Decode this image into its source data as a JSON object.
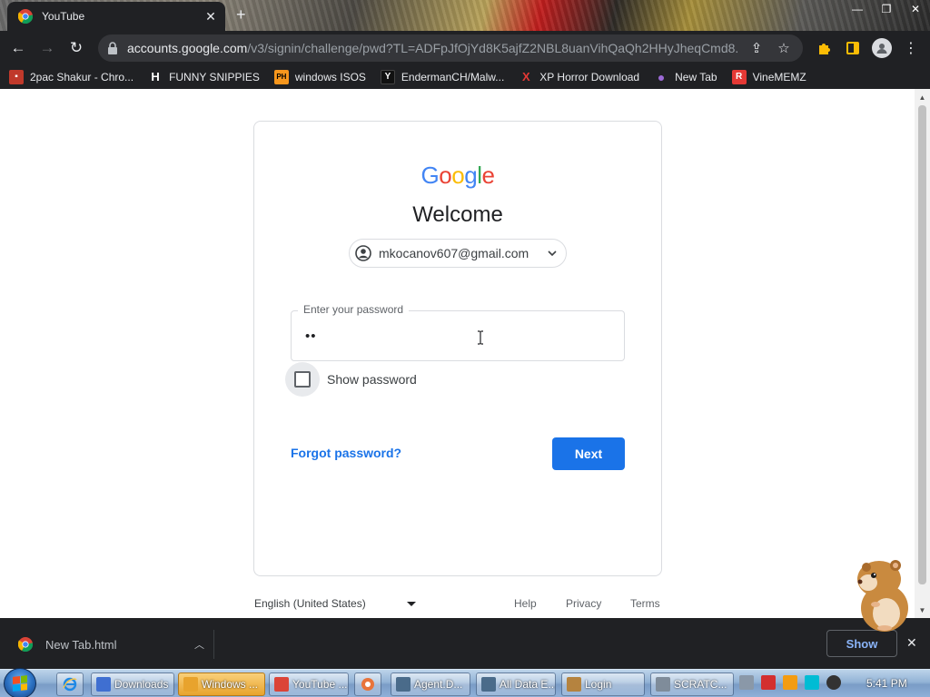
{
  "browser": {
    "tab": {
      "title": "YouTube",
      "favicon": "chrome-icon"
    },
    "url": {
      "host": "accounts.google.com",
      "path": "/v3/signin/challenge/pwd?TL=ADFpJfOjYd8K5ajfZ2NBL8uanVihQaQh2HHyJheqCmd8..."
    },
    "bookmarks": [
      {
        "label": "2pac Shakur - Chro...",
        "icon": "bookmark-icon-2pac",
        "color": "#c0392b"
      },
      {
        "label": "FUNNY SNIPPIES",
        "icon": "h-icon",
        "color": "#ffffff"
      },
      {
        "label": "windows ISOS",
        "icon": "ph-icon",
        "color": "#f7971d"
      },
      {
        "label": "EndermanCH/Malw...",
        "icon": "youtube-yt-icon",
        "color": "#111111"
      },
      {
        "label": "XP Horror Download",
        "icon": "x-icon",
        "color": "#e53935"
      },
      {
        "label": "New Tab",
        "icon": "globe-icon",
        "color": "#9c6ad6"
      },
      {
        "label": "VineMEMZ",
        "icon": "r-icon",
        "color": "#e53935"
      }
    ]
  },
  "signin": {
    "logo_text": "Google",
    "logo_colors": [
      "#4285F4",
      "#EA4335",
      "#FBBC05",
      "#4285F4",
      "#34A853",
      "#EA4335"
    ],
    "heading": "Welcome",
    "account_email": "mkocanov607@gmail.com",
    "password_label": "Enter your password",
    "password_value": "••",
    "show_password_label": "Show password",
    "forgot_label": "Forgot password?",
    "next_label": "Next",
    "accent": "#1a73e8"
  },
  "footer": {
    "language": "English (United States)",
    "links": [
      "Help",
      "Privacy",
      "Terms"
    ]
  },
  "downloads": {
    "item_name": "New Tab.html",
    "show_all_label": "Show"
  },
  "taskbar": {
    "items": [
      {
        "label": "Downloads",
        "icon": "folder-icon",
        "color": "#3f6fd1"
      },
      {
        "label": "Windows ...",
        "icon": "media-player-icon",
        "color": "#e8a32d",
        "active": true
      },
      {
        "label": "YouTube ...",
        "icon": "chrome-icon",
        "color": "#db4437"
      },
      {
        "label": "Agent.D...",
        "icon": "window-icon",
        "color": "#4a6b8a"
      },
      {
        "label": "All Data E...",
        "icon": "window-icon",
        "color": "#4a6b8a"
      },
      {
        "label": "Login",
        "icon": "hamster-icon",
        "color": "#b5833f"
      },
      {
        "label": "SCRATC...",
        "icon": "tools-icon",
        "color": "#7f8c9a"
      }
    ],
    "clock": "5:41 PM"
  }
}
